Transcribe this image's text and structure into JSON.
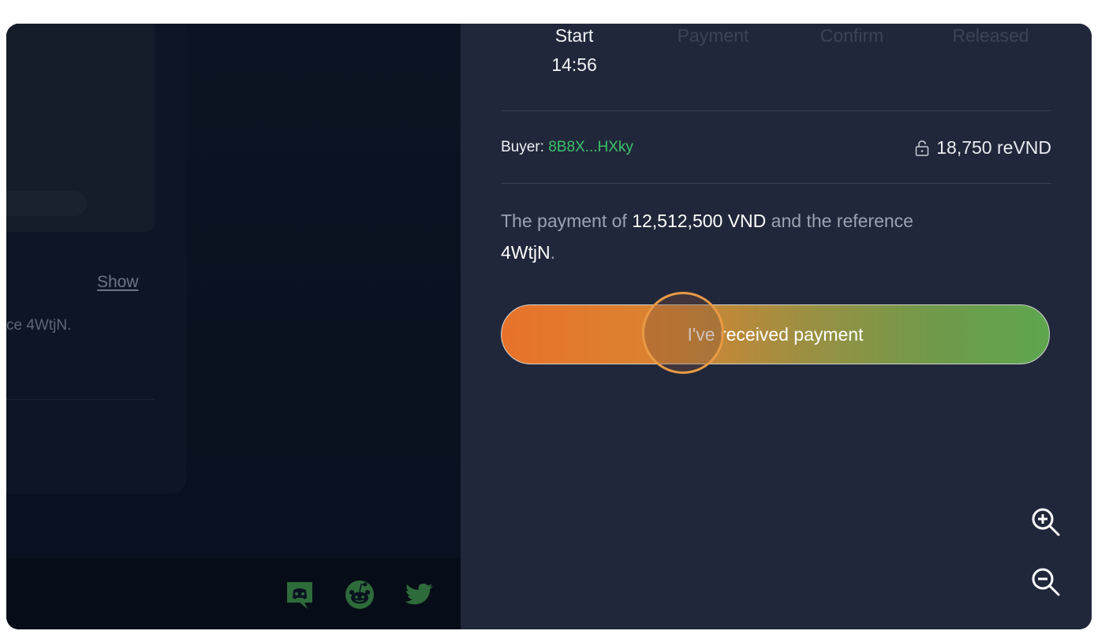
{
  "left_panel": {
    "show_link": "Show",
    "reference_text": "ce 4WtjN."
  },
  "footer": {
    "social": [
      "discord-icon",
      "reddit-icon",
      "twitter-icon"
    ],
    "social_color": "#2e6b3a"
  },
  "steps": [
    {
      "label": "Start",
      "time": "14:56",
      "active": true
    },
    {
      "label": "Payment",
      "active": false
    },
    {
      "label": "Confirm",
      "active": false
    },
    {
      "label": "Released",
      "active": false
    }
  ],
  "buyer": {
    "label": "Buyer:",
    "address": "8B8X...HXky",
    "locked_amount": "18,750 reVND"
  },
  "message": {
    "prefix": "The payment of",
    "amount": "12,512,500 VND",
    "middle": "and the reference",
    "reference": "4WtjN",
    "suffix": "."
  },
  "cta": {
    "label": "I've received payment"
  },
  "zoom": [
    "zoom-in-icon",
    "zoom-out-icon"
  ],
  "colors": {
    "panel_bg": "#21273a",
    "accent_green": "#3bc26a",
    "gradient_start": "#e8722a",
    "gradient_end": "#5ea650",
    "cursor_ring": "#e99a45"
  }
}
